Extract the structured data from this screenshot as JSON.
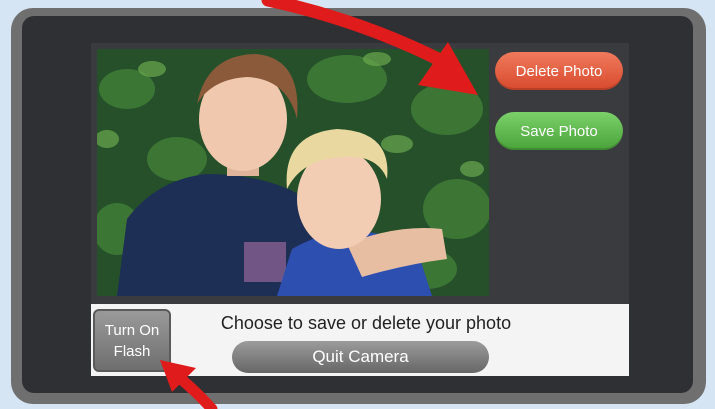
{
  "camera": {
    "photo_alt": "Two boys posing in front of green leaves",
    "delete_label": "Delete Photo",
    "save_label": "Save Photo",
    "flash_label_line1": "Turn On",
    "flash_label_line2": "Flash",
    "prompt": "Choose to save or delete your photo",
    "quit_label": "Quit Camera"
  },
  "colors": {
    "delete": "#e0553a",
    "save": "#5cba49",
    "annotation_arrow": "#e01b1b"
  },
  "icons": [
    "annotation-arrow-icon"
  ]
}
